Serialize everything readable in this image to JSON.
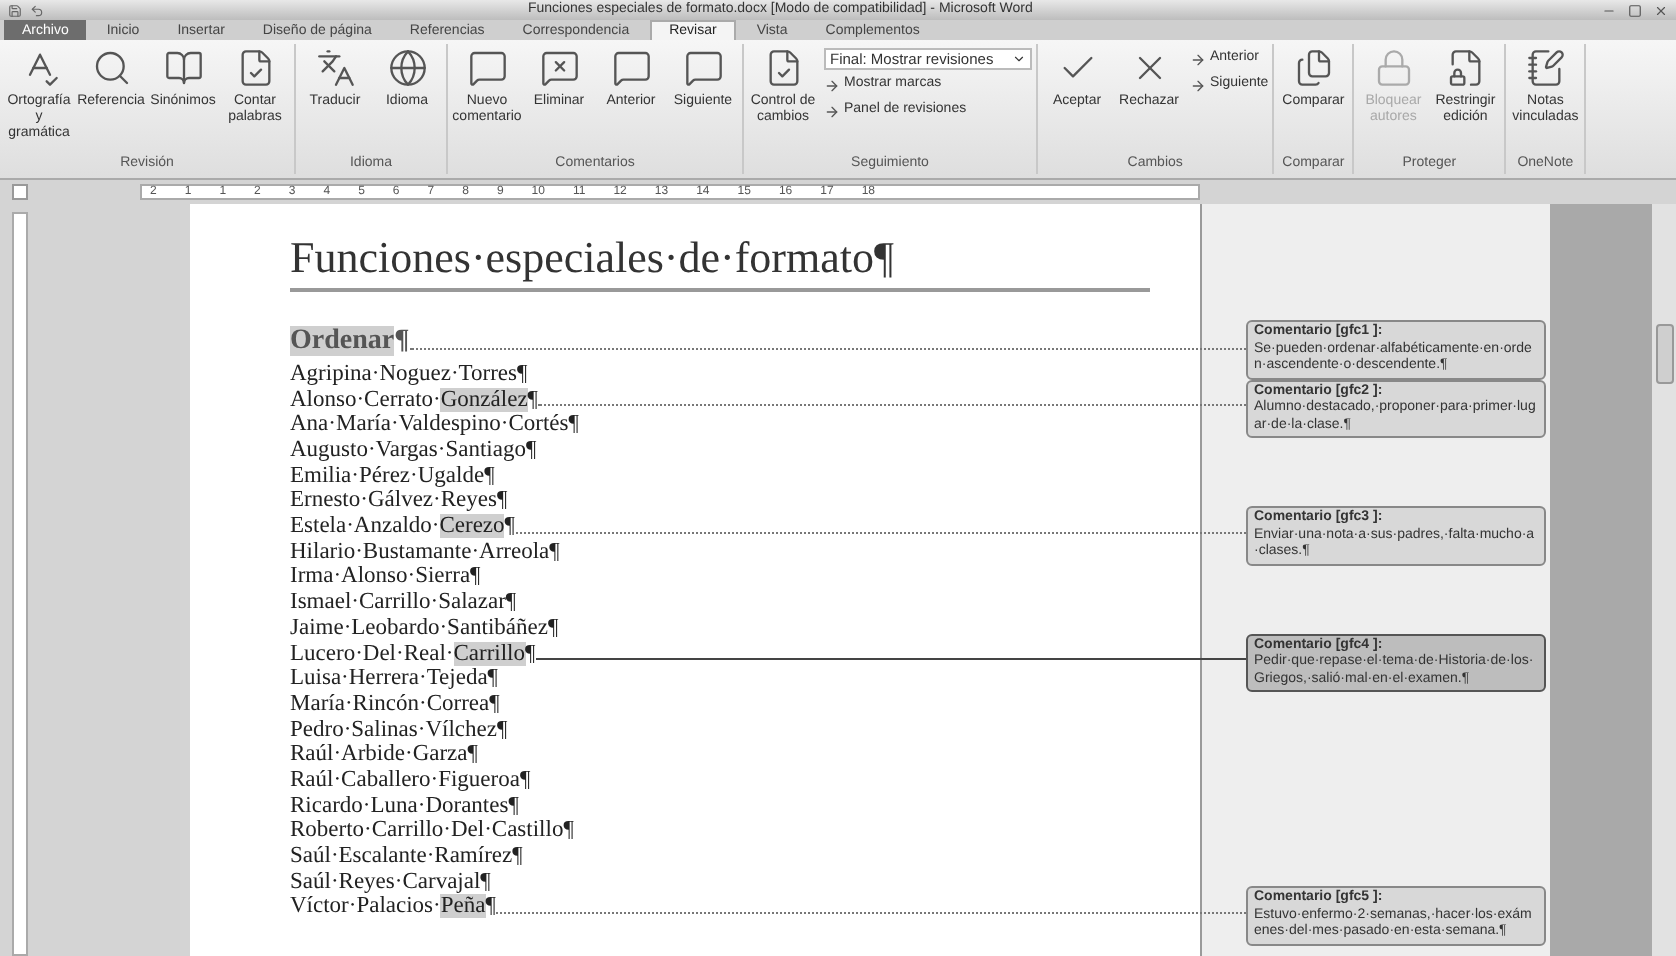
{
  "window": {
    "title": "Funciones especiales de formato.docx [Modo de compatibilidad] - Microsoft Word"
  },
  "tabs": [
    {
      "label": "Archivo",
      "kind": "file",
      "selected": false
    },
    {
      "label": "Inicio",
      "kind": "tab",
      "selected": false
    },
    {
      "label": "Insertar",
      "kind": "tab",
      "selected": false
    },
    {
      "label": "Diseño de página",
      "kind": "tab",
      "selected": false
    },
    {
      "label": "Referencias",
      "kind": "tab",
      "selected": false
    },
    {
      "label": "Correspondencia",
      "kind": "tab",
      "selected": false
    },
    {
      "label": "Revisar",
      "kind": "tab",
      "selected": true
    },
    {
      "label": "Vista",
      "kind": "tab",
      "selected": false
    },
    {
      "label": "Complementos",
      "kind": "tab",
      "selected": false
    }
  ],
  "ribbon": [
    {
      "label": "Revisión",
      "buttons": [
        {
          "label": "Ortografía y gramática",
          "kind": "large",
          "disabled": false
        },
        {
          "label": "Referencia",
          "kind": "large",
          "disabled": false
        },
        {
          "label": "Sinónimos",
          "kind": "large",
          "disabled": false
        },
        {
          "label": "Contar palabras",
          "kind": "large",
          "disabled": false
        }
      ]
    },
    {
      "label": "Idioma",
      "buttons": [
        {
          "label": "Traducir",
          "kind": "large",
          "disabled": false
        },
        {
          "label": "Idioma",
          "kind": "large",
          "disabled": false
        }
      ]
    },
    {
      "label": "Comentarios",
      "buttons": [
        {
          "label": "Nuevo comentario",
          "kind": "large",
          "disabled": false
        },
        {
          "label": "Eliminar",
          "kind": "large",
          "disabled": false
        },
        {
          "label": "Anterior",
          "kind": "large",
          "disabled": false
        },
        {
          "label": "Siguiente",
          "kind": "large",
          "disabled": false
        }
      ]
    },
    {
      "label": "Seguimiento",
      "buttons": [
        {
          "label": "Control de cambios",
          "kind": "large",
          "disabled": false
        },
        {
          "label": "Final: Mostrar revisiones",
          "kind": "dropdown",
          "disabled": false
        },
        {
          "label": "Mostrar marcas",
          "kind": "small",
          "disabled": false
        },
        {
          "label": "Panel de revisiones",
          "kind": "small",
          "disabled": false
        }
      ]
    },
    {
      "label": "Cambios",
      "buttons": [
        {
          "label": "Aceptar",
          "kind": "large",
          "disabled": false
        },
        {
          "label": "Rechazar",
          "kind": "large",
          "disabled": false
        },
        {
          "label": "Anterior",
          "kind": "small",
          "disabled": false
        },
        {
          "label": "Siguiente",
          "kind": "small",
          "disabled": false
        }
      ]
    },
    {
      "label": "Comparar",
      "buttons": [
        {
          "label": "Comparar",
          "kind": "large",
          "disabled": false
        }
      ]
    },
    {
      "label": "Proteger",
      "buttons": [
        {
          "label": "Bloquear autores",
          "kind": "large",
          "disabled": true
        },
        {
          "label": "Restringir edición",
          "kind": "large",
          "disabled": false
        }
      ]
    },
    {
      "label": "OneNote",
      "buttons": [
        {
          "label": "Notas vinculadas",
          "kind": "large",
          "disabled": false
        }
      ]
    }
  ],
  "ruler": {
    "left_labels": [
      "2",
      "1"
    ],
    "labels": [
      "1",
      "2",
      "3",
      "4",
      "5",
      "6",
      "7",
      "8",
      "9",
      "10",
      "11",
      "12",
      "13",
      "14",
      "15",
      "16",
      "17",
      "18"
    ]
  },
  "document": {
    "title": "Funciones·especiales·de·formato¶",
    "lines": [
      {
        "kind": "heading",
        "parts": [
          {
            "text": "Ordenar",
            "highlighted": true
          },
          {
            "text": "¶",
            "highlighted": false
          }
        ],
        "comment": {
          "label": "Comentario [gfc1 ]:",
          "text": "Se·pueden·ordenar·alfabéticamente·en·orden·ascendente·o·descendente.¶",
          "selected": false
        }
      },
      {
        "kind": "name",
        "parts": [
          {
            "text": "Agripina·Noguez·Torres¶",
            "highlighted": false
          }
        ]
      },
      {
        "kind": "name",
        "parts": [
          {
            "text": "Alonso·Cerrato·",
            "highlighted": false
          },
          {
            "text": "González",
            "highlighted": true
          },
          {
            "text": "¶",
            "highlighted": false
          }
        ],
        "comment": {
          "label": "Comentario [gfc2 ]:",
          "text": "Alumno·destacado,·proponer·para·primer·lugar·de·la·clase.¶",
          "selected": false
        }
      },
      {
        "kind": "name",
        "parts": [
          {
            "text": "Ana·María·Valdespino·Cortés¶",
            "highlighted": false
          }
        ]
      },
      {
        "kind": "name",
        "parts": [
          {
            "text": "Augusto·Vargas·Santiago¶",
            "highlighted": false
          }
        ]
      },
      {
        "kind": "name",
        "parts": [
          {
            "text": "Emilia·Pérez·Ugalde¶",
            "highlighted": false
          }
        ]
      },
      {
        "kind": "name",
        "parts": [
          {
            "text": "Ernesto·Gálvez·Reyes¶",
            "highlighted": false
          }
        ]
      },
      {
        "kind": "name",
        "parts": [
          {
            "text": "Estela·Anzaldo·",
            "highlighted": false
          },
          {
            "text": "Cerezo",
            "highlighted": true
          },
          {
            "text": "¶",
            "highlighted": false
          }
        ],
        "comment": {
          "label": "Comentario [gfc3 ]:",
          "text": "Enviar·una·nota·a·sus·padres,·falta·mucho·a·clases.¶",
          "selected": false
        }
      },
      {
        "kind": "name",
        "parts": [
          {
            "text": "Hilario·Bustamante·Arreola¶",
            "highlighted": false
          }
        ]
      },
      {
        "kind": "name",
        "parts": [
          {
            "text": "Irma·Alonso·Sierra¶",
            "highlighted": false
          }
        ]
      },
      {
        "kind": "name",
        "parts": [
          {
            "text": "Ismael·Carrillo·Salazar¶",
            "highlighted": false
          }
        ]
      },
      {
        "kind": "name",
        "parts": [
          {
            "text": "Jaime·Leobardo·Santibáñez¶",
            "highlighted": false
          }
        ]
      },
      {
        "kind": "name",
        "parts": [
          {
            "text": "Lucero·Del·Real·",
            "highlighted": false
          },
          {
            "text": "Carrillo",
            "highlighted": true
          },
          {
            "text": "¶",
            "highlighted": false
          }
        ],
        "comment": {
          "label": "Comentario [gfc4 ]:",
          "text": "Pedir·que·repase·el·tema·de·Historia·de·los·Griegos,·salió·mal·en·el·examen.¶",
          "selected": true
        }
      },
      {
        "kind": "name",
        "parts": [
          {
            "text": "Luisa·Herrera·Tejeda¶",
            "highlighted": false
          }
        ]
      },
      {
        "kind": "name",
        "parts": [
          {
            "text": "María·Rincón·Correa¶",
            "highlighted": false
          }
        ]
      },
      {
        "kind": "name",
        "parts": [
          {
            "text": "Pedro·Salinas·Vílchez¶",
            "highlighted": false
          }
        ]
      },
      {
        "kind": "name",
        "parts": [
          {
            "text": "Raúl·Arbide·Garza¶",
            "highlighted": false
          }
        ]
      },
      {
        "kind": "name",
        "parts": [
          {
            "text": "Raúl·Caballero·Figueroa¶",
            "highlighted": false
          }
        ]
      },
      {
        "kind": "name",
        "parts": [
          {
            "text": "Ricardo·Luna·Dorantes¶",
            "highlighted": false
          }
        ]
      },
      {
        "kind": "name",
        "parts": [
          {
            "text": "Roberto·Carrillo·Del·Castillo¶",
            "highlighted": false
          }
        ]
      },
      {
        "kind": "name",
        "parts": [
          {
            "text": "Saúl·Escalante·Ramírez¶",
            "highlighted": false
          }
        ]
      },
      {
        "kind": "name",
        "parts": [
          {
            "text": "Saúl·Reyes·Carvajal¶",
            "highlighted": false
          }
        ]
      },
      {
        "kind": "name",
        "parts": [
          {
            "text": "Víctor·Palacios·",
            "highlighted": false
          },
          {
            "text": "Peña",
            "highlighted": true
          },
          {
            "text": "¶",
            "highlighted": false
          }
        ],
        "comment": {
          "label": "Comentario [gfc5 ]:",
          "text": "Estuvo·enfermo·2·semanas,·hacer·los·exámenes·del·mes·pasado·en·esta·semana.¶",
          "selected": false
        }
      }
    ]
  }
}
